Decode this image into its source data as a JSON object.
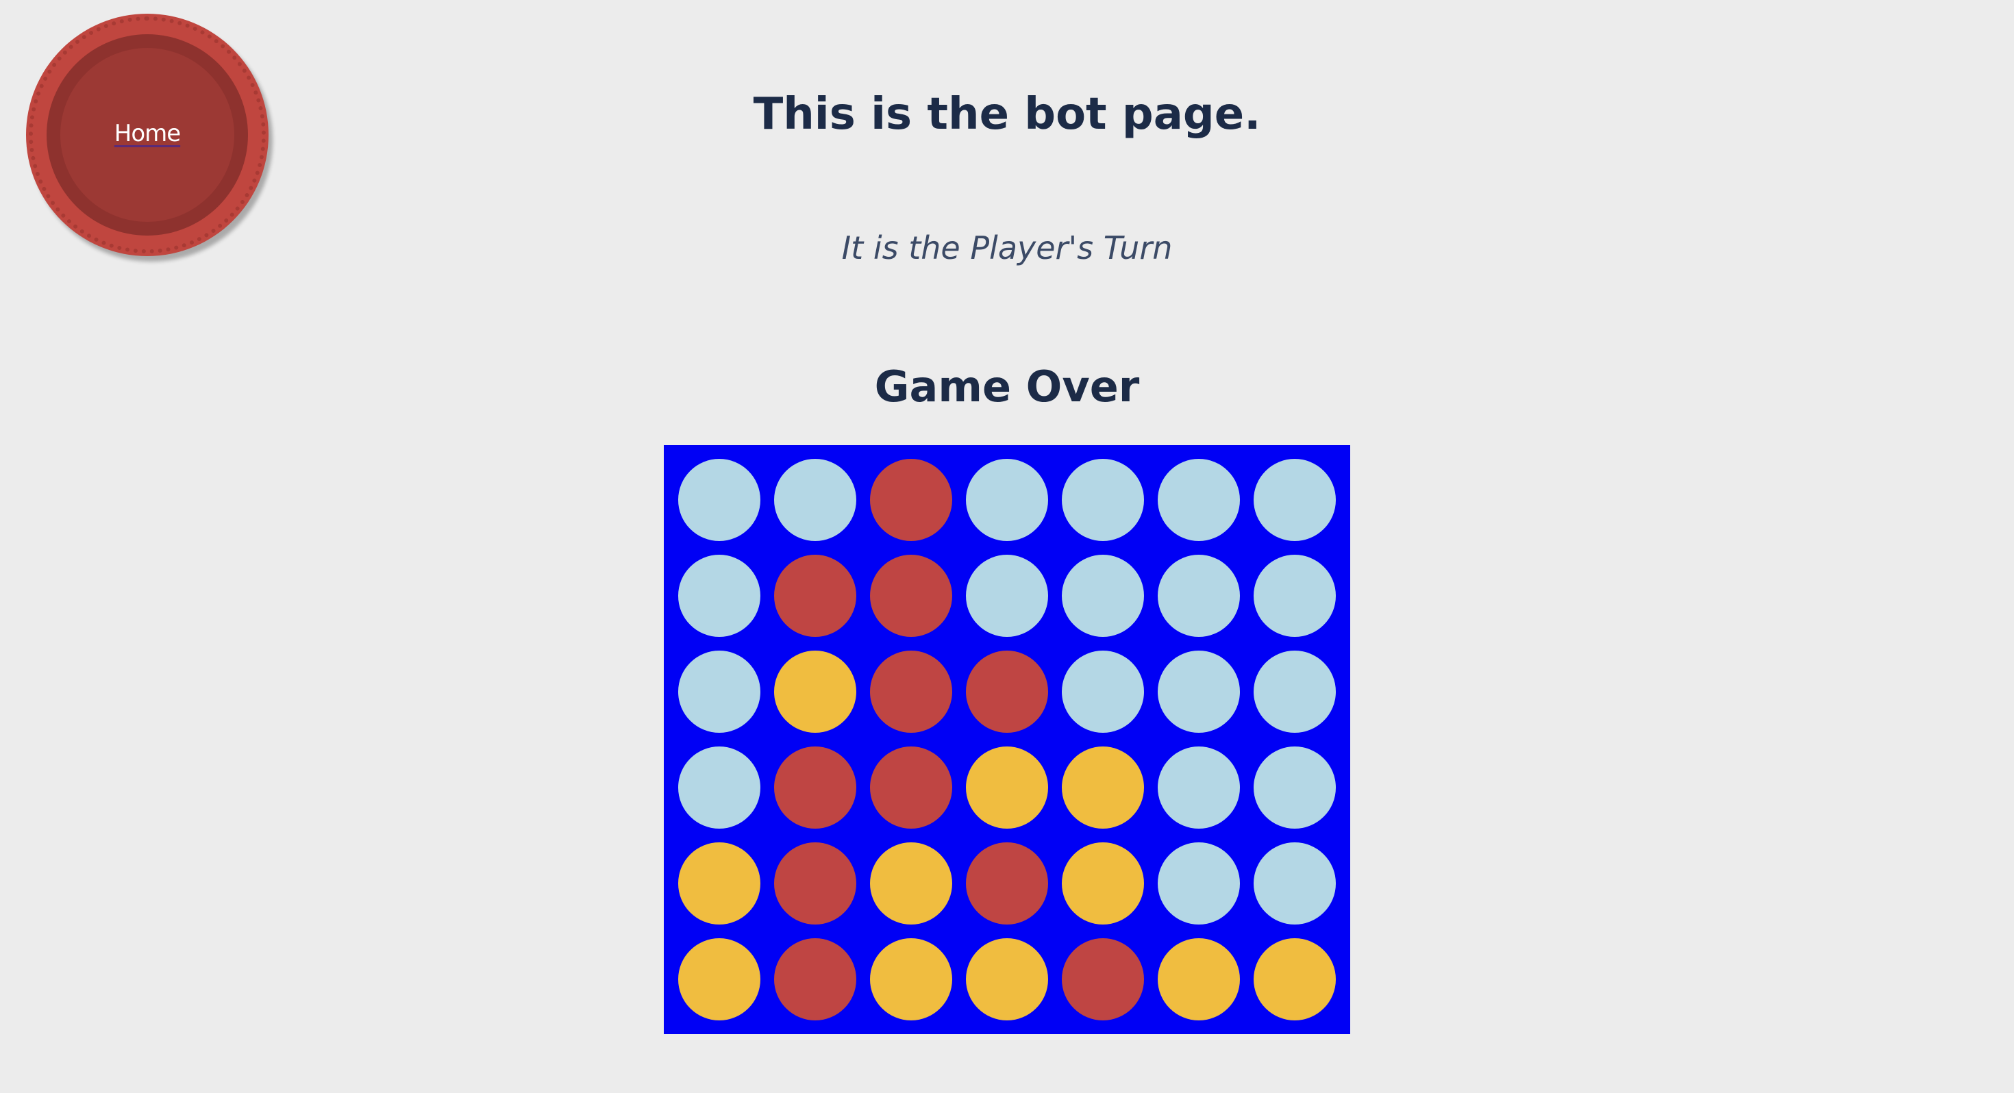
{
  "home": {
    "label": "Home"
  },
  "header": {
    "title": "This is the bot page.",
    "turn_status": "It is the Player's Turn",
    "game_status": "Game Over"
  },
  "colors": {
    "empty": "#b4d7e5",
    "red": "#bf4543",
    "yellow": "#f0bd40",
    "board": "#0000f5"
  },
  "board": {
    "columns": 7,
    "rows": 6,
    "cells": [
      [
        "empty",
        "empty",
        "red",
        "empty",
        "empty",
        "empty",
        "empty"
      ],
      [
        "empty",
        "red",
        "red",
        "empty",
        "empty",
        "empty",
        "empty"
      ],
      [
        "empty",
        "yellow",
        "red",
        "red",
        "empty",
        "empty",
        "empty"
      ],
      [
        "empty",
        "red",
        "red",
        "yellow",
        "yellow",
        "empty",
        "empty"
      ],
      [
        "yellow",
        "red",
        "yellow",
        "red",
        "yellow",
        "empty",
        "empty"
      ],
      [
        "yellow",
        "red",
        "yellow",
        "yellow",
        "red",
        "yellow",
        "yellow"
      ]
    ]
  }
}
